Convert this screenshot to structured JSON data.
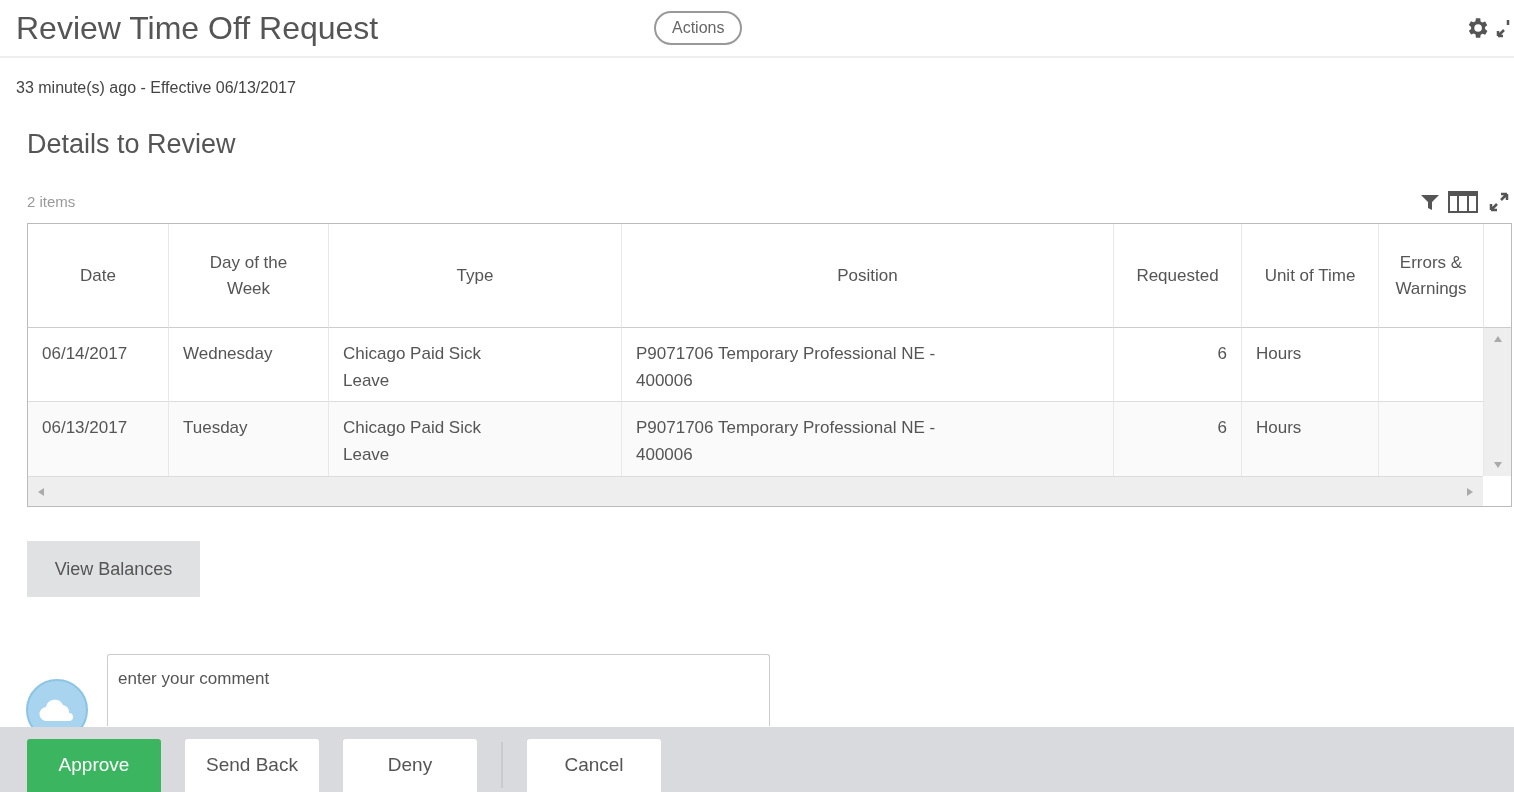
{
  "header": {
    "title": "Review Time Off Request",
    "actions_button": "Actions"
  },
  "subtitle": "33 minute(s) ago - Effective 06/13/2017",
  "section": {
    "title": "Details to Review",
    "count": "2 items"
  },
  "table": {
    "columns": [
      "Date",
      "Day of the Week",
      "Type",
      "Position",
      "Requested",
      "Unit of Time",
      "Errors & Warnings"
    ],
    "rows": [
      {
        "cells": [
          "06/14/2017",
          "Wednesday",
          "Chicago Paid Sick Leave",
          "P9071706 Temporary Professional NE - 400006",
          "6",
          "Hours",
          ""
        ]
      },
      {
        "cells": [
          "06/13/2017",
          "Tuesday",
          "Chicago Paid Sick Leave",
          "P9071706 Temporary Professional NE - 400006",
          "6",
          "Hours",
          ""
        ]
      }
    ]
  },
  "view_balances_button": "View Balances",
  "comment": {
    "placeholder": "enter your comment"
  },
  "footer": {
    "buttons": [
      {
        "label": "Approve",
        "kind": "primary"
      },
      {
        "label": "Send Back",
        "kind": "secondary"
      },
      {
        "label": "Deny",
        "kind": "secondary"
      },
      {
        "label": "Cancel",
        "kind": "separated"
      }
    ]
  }
}
